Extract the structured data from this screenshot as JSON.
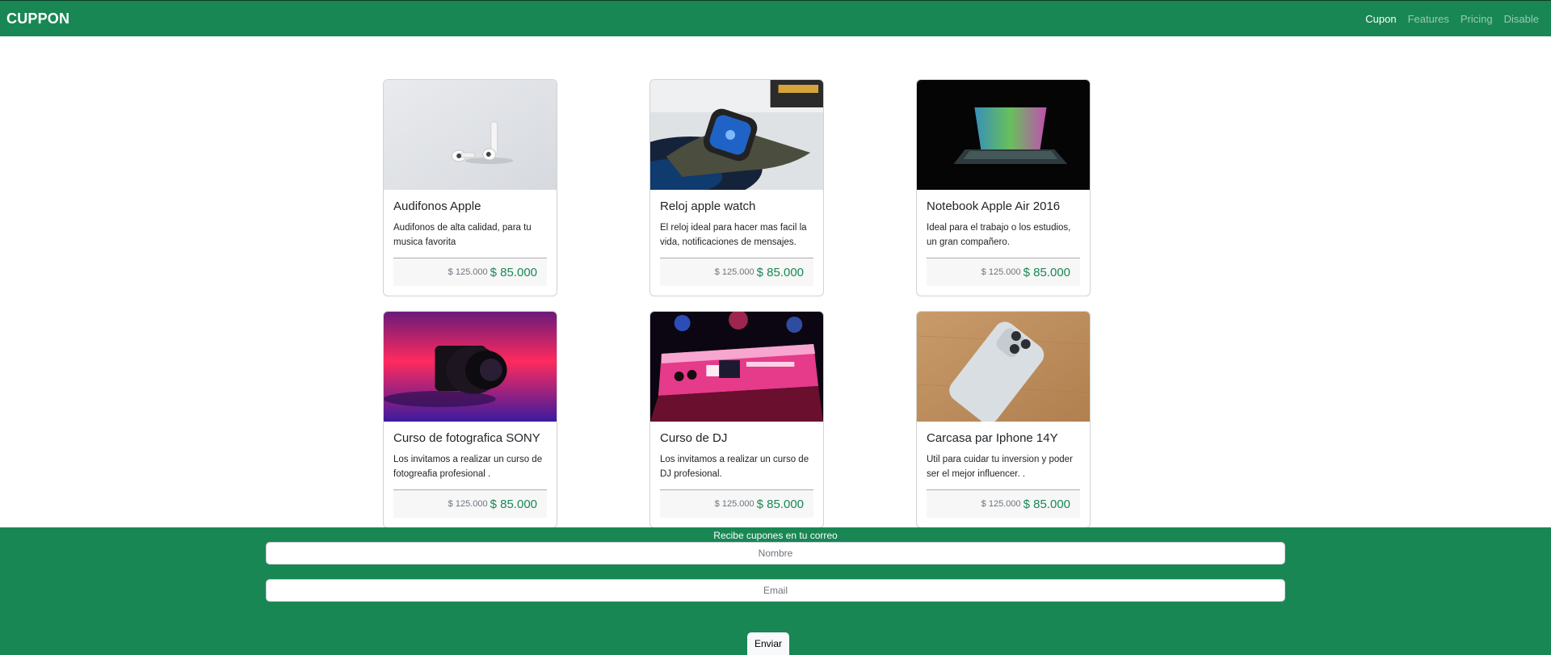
{
  "navbar": {
    "brand": "CUPPON",
    "links": [
      {
        "label": "Cupon",
        "active": true
      },
      {
        "label": "Features",
        "active": false
      },
      {
        "label": "Pricing",
        "active": false
      },
      {
        "label": "Disable",
        "active": false
      }
    ]
  },
  "products": [
    {
      "title": "Audifonos Apple",
      "text": "Audifonos de alta calidad, para tu musica favorita",
      "old_price": "$ 125.000",
      "price": "$ 85.000",
      "image": "airpods-photo"
    },
    {
      "title": "Reloj apple watch",
      "text": "El reloj ideal para hacer mas facil la vida, notificaciones de mensajes.",
      "old_price": "$ 125.000",
      "price": "$ 85.000",
      "image": "apple-watch-photo"
    },
    {
      "title": "Notebook Apple Air 2016",
      "text": "Ideal para el trabajo o los estudios, un gran compañero.",
      "old_price": "$ 125.000",
      "price": "$ 85.000",
      "image": "macbook-photo"
    },
    {
      "title": "Curso de fotografica SONY",
      "text": "Los invitamos a realizar un curso de fotogreafia profesional .",
      "old_price": "$ 125.000",
      "price": "$ 85.000",
      "image": "camera-photo"
    },
    {
      "title": "Curso de DJ",
      "text": "Los invitamos a realizar un curso de DJ profesional.",
      "old_price": "$ 125.000",
      "price": "$ 85.000",
      "image": "dj-mixer-photo"
    },
    {
      "title": "Carcasa par Iphone 14Y",
      "text": "Util para cuidar tu inversion y poder ser el mejor influencer. .",
      "old_price": "$ 125.000",
      "price": "$ 85.000",
      "image": "iphone-photo"
    }
  ],
  "newsletter": {
    "title": "Recibe cupones en tu correo",
    "name_placeholder": "Nombre",
    "email_placeholder": "Email",
    "submit_label": "Enviar"
  },
  "colors": {
    "brand_green": "#198754",
    "price_green": "#198754"
  }
}
